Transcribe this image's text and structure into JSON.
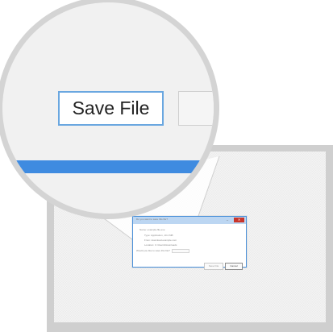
{
  "magnifier": {
    "save_label": "Save File",
    "accent_color": "#3f8be0"
  },
  "dialog": {
    "title": "Do you want to save this file?",
    "minimize_icon": "minimize-icon",
    "close_icon": "close-icon",
    "lines": [
      "Name: example-file.exe",
      "Type: Application, 10.2 MB",
      "From: download.example.com",
      "Location: C:\\Users\\Downloads",
      "Would you like to save this file?"
    ],
    "save_label": "Save File",
    "cancel_label": "Cancel"
  }
}
